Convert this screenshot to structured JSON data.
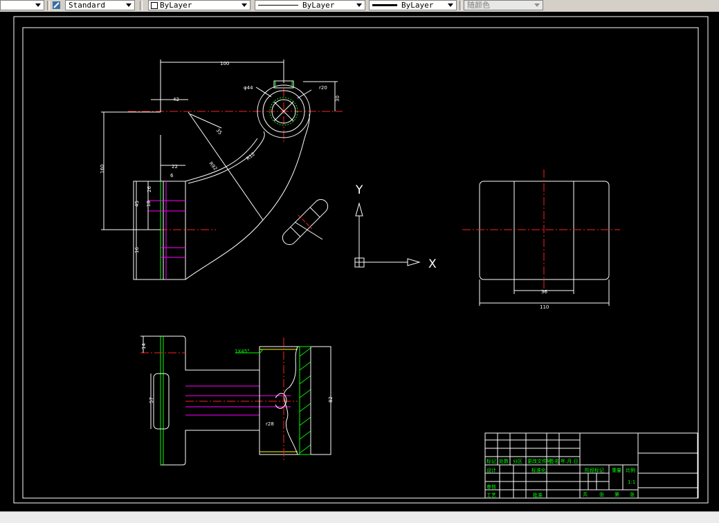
{
  "toolbar": {
    "text_style": "Standard",
    "layer": "ByLayer",
    "linetype": "ByLayer",
    "lineweight": "ByLayer",
    "plot_style": "随颜色"
  },
  "drawing": {
    "dimensions": {
      "d100": "100",
      "d42": "42",
      "phi44": "φ44",
      "r20": "r20",
      "d30": "30",
      "d160": "160",
      "d22": "22",
      "d6": "6",
      "d26": "26",
      "d18": "18",
      "d45": "45",
      "d16": "16",
      "d35": "35",
      "r92": "R92",
      "r12": "R12",
      "d110": "110",
      "d36": "36",
      "chamfer": "1X45°",
      "d14": "14",
      "d57": "57",
      "r28": "r28",
      "d82": "82"
    },
    "ucs": {
      "y_label": "Y",
      "x_label": "X"
    },
    "title_block": {
      "h1": "标记",
      "h2": "处数",
      "h3": "分区",
      "h4": "更改文件号",
      "h5": "签名",
      "h6": "年.月.日",
      "r1": "设计",
      "r1b": "标准化",
      "r2": "审核",
      "r3": "工艺",
      "r3b": "批准",
      "stage": "阶段标记",
      "weight": "重量",
      "scale": "比例",
      "scale_value": "1:1",
      "sheets": [
        "共",
        "张",
        "第",
        "张"
      ]
    }
  }
}
